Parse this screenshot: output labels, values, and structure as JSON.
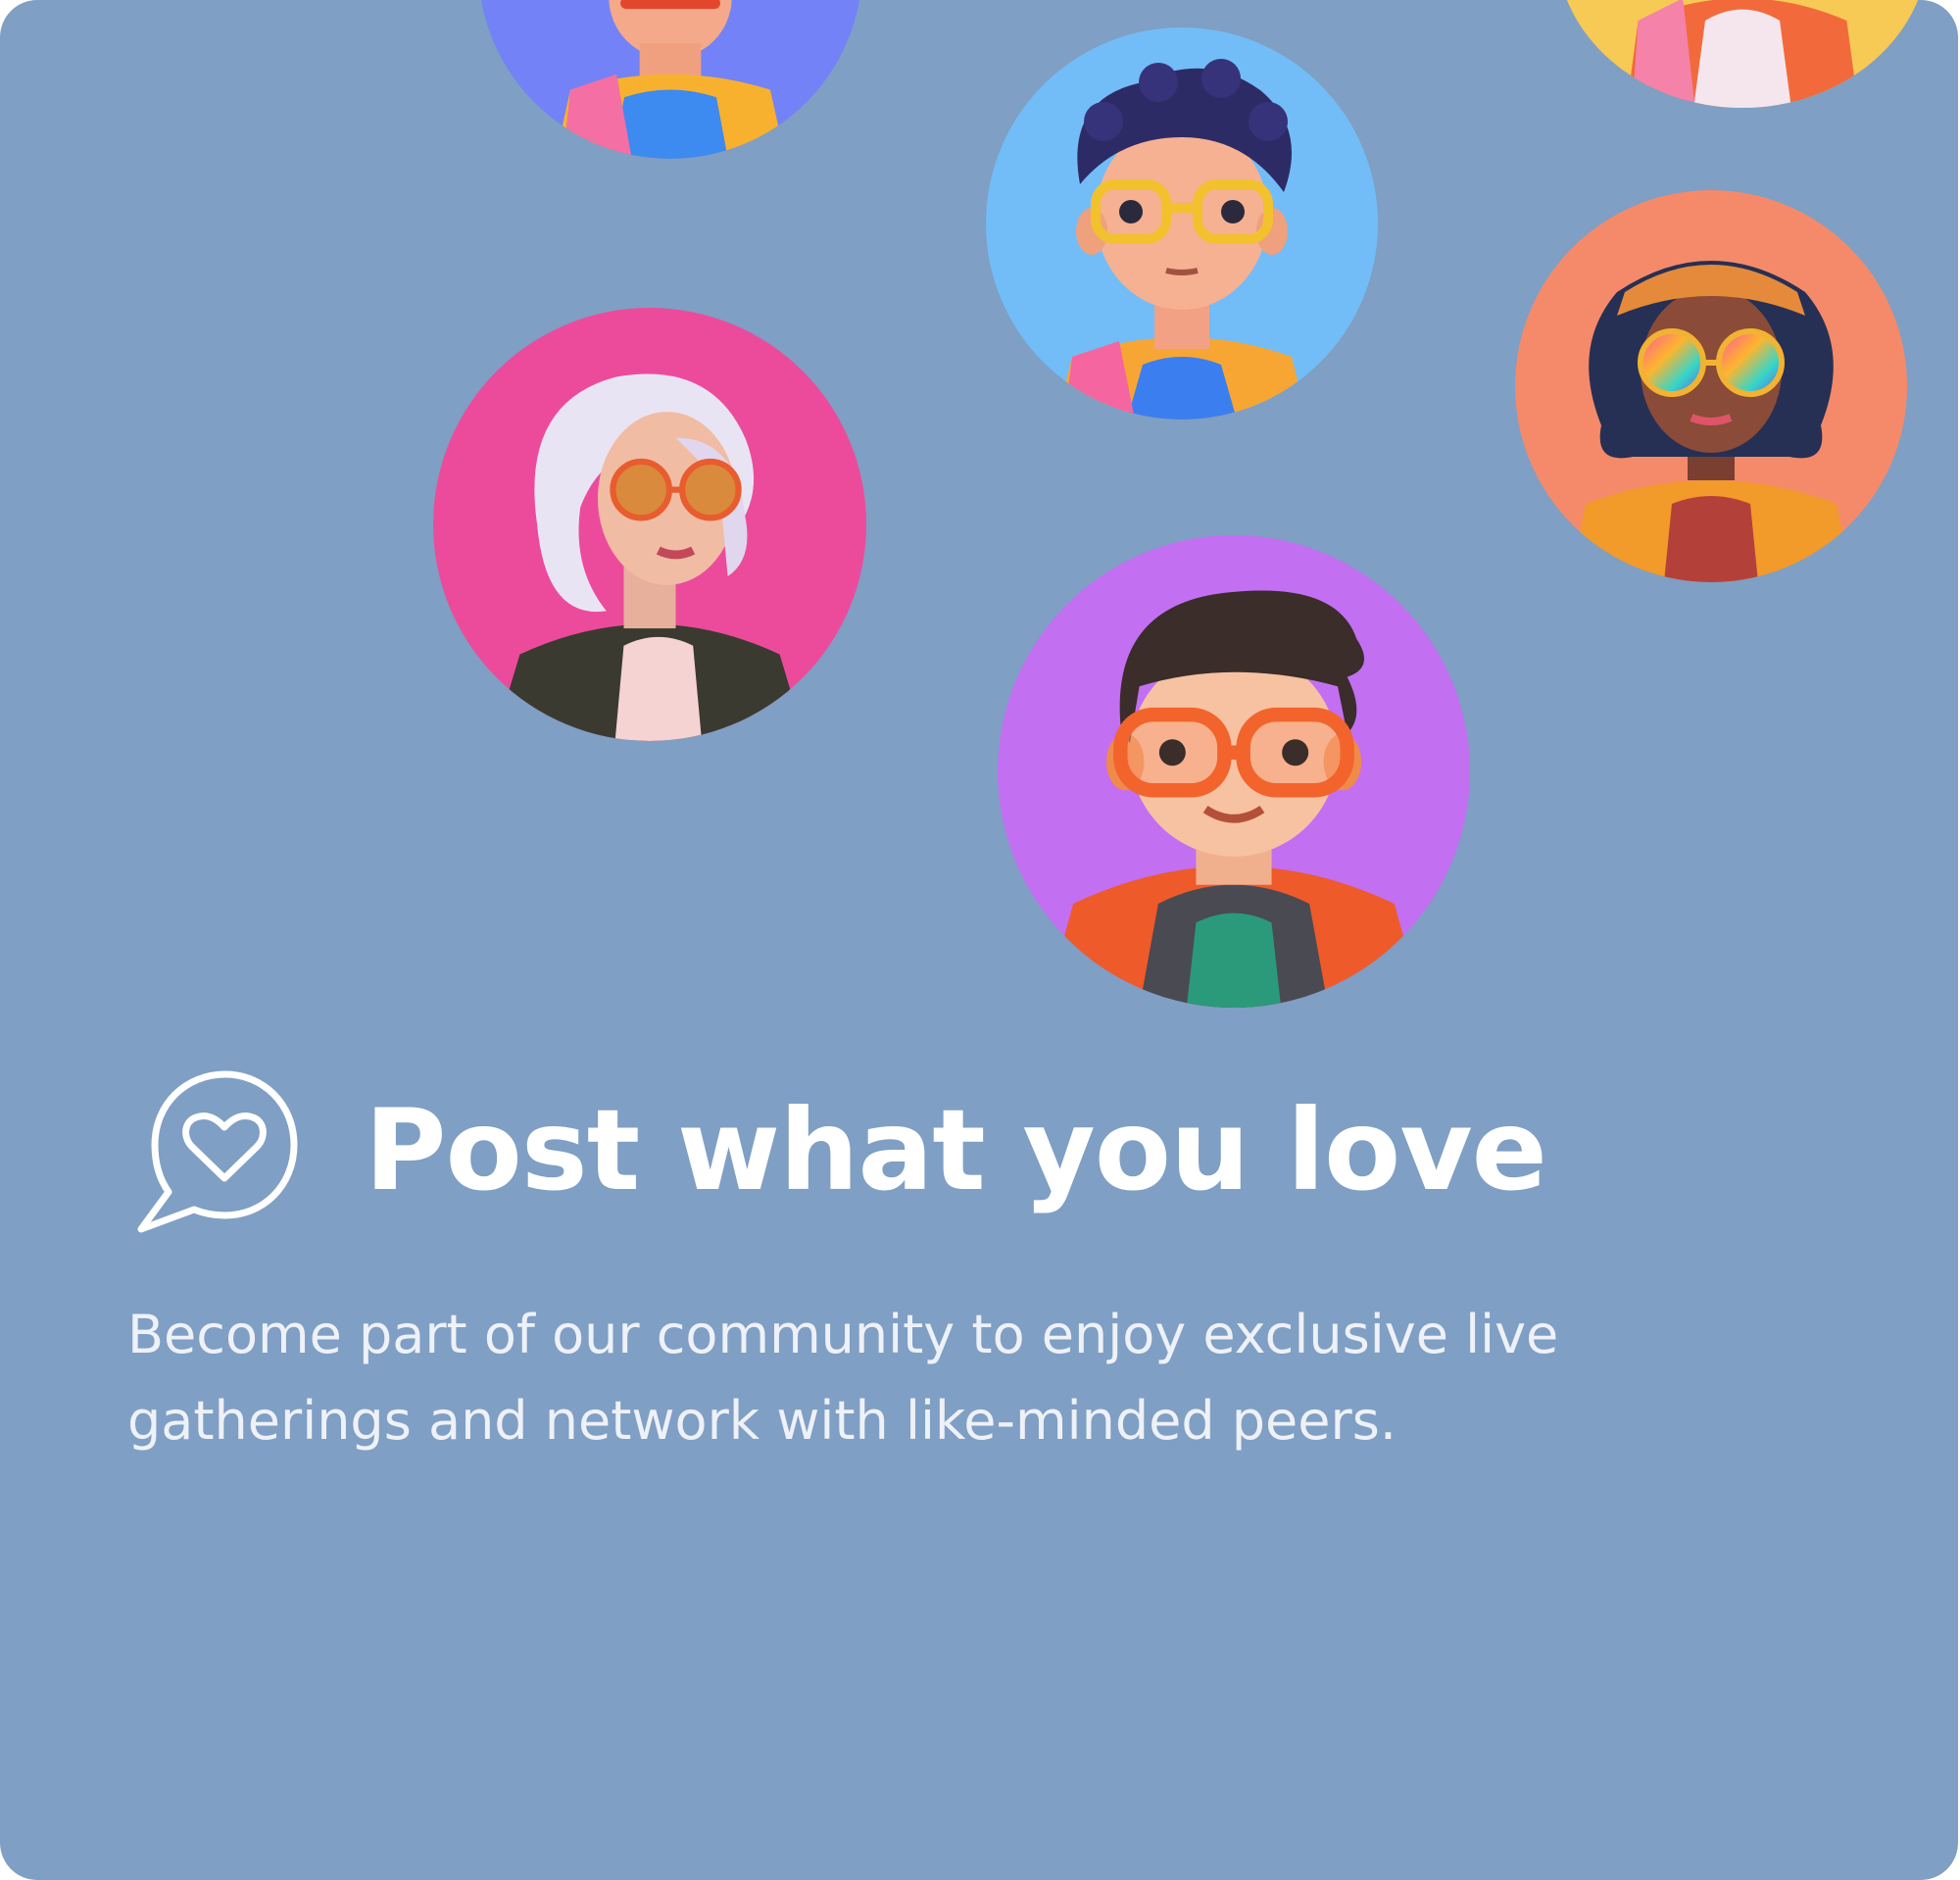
{
  "card": {
    "background_color": "#7f9fc4",
    "heading": {
      "icon": "chat-bubble-heart-icon",
      "title": "Post what you love"
    },
    "description": "Become part of our community to enjoy exclusive live gatherings and network with like-minded peers."
  },
  "avatars": [
    {
      "name": "avatar-boy-blue-bg",
      "background": "#7382f7"
    },
    {
      "name": "avatar-curly-boy-glasses",
      "background": "#72bdf7"
    },
    {
      "name": "avatar-girl-yellow-bg",
      "background": "#f7c955"
    },
    {
      "name": "avatar-girl-rainbow-sunglasses",
      "background": "#f58a6a"
    },
    {
      "name": "avatar-woman-white-hair",
      "background": "#ec4b9c"
    },
    {
      "name": "avatar-boy-orange-glasses",
      "background": "#c26ff2"
    }
  ]
}
